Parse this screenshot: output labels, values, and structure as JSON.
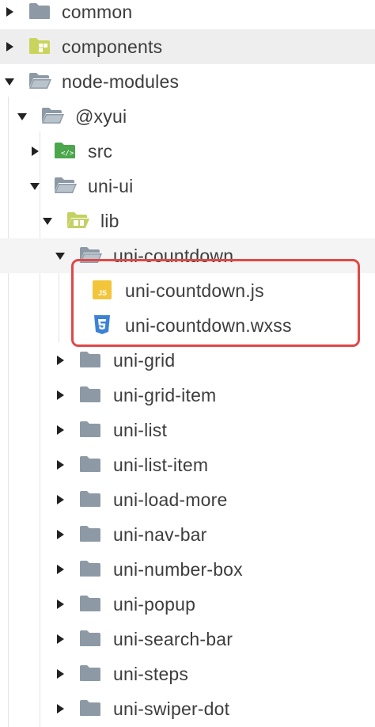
{
  "tree": {
    "items": [
      {
        "label": "common",
        "icon": "folder-icon",
        "expanded": false
      },
      {
        "label": "components",
        "icon": "folder-components-icon",
        "expanded": false,
        "selected": true
      },
      {
        "label": "node-modules",
        "icon": "folder-open-icon",
        "expanded": true
      },
      {
        "label": "@xyui",
        "icon": "folder-open-icon",
        "expanded": true
      },
      {
        "label": "src",
        "icon": "folder-src-icon",
        "expanded": false
      },
      {
        "label": "uni-ui",
        "icon": "folder-open-icon",
        "expanded": true
      },
      {
        "label": "lib",
        "icon": "folder-lib-open-icon",
        "expanded": true
      },
      {
        "label": "uni-countdown",
        "icon": "folder-open-icon",
        "expanded": true
      },
      {
        "label": "uni-countdown.js",
        "icon": "js-file-icon"
      },
      {
        "label": "uni-countdown.wxss",
        "icon": "css-file-icon"
      },
      {
        "label": "uni-grid",
        "icon": "folder-icon",
        "expanded": false
      },
      {
        "label": "uni-grid-item",
        "icon": "folder-icon",
        "expanded": false
      },
      {
        "label": "uni-list",
        "icon": "folder-icon",
        "expanded": false
      },
      {
        "label": "uni-list-item",
        "icon": "folder-icon",
        "expanded": false
      },
      {
        "label": "uni-load-more",
        "icon": "folder-icon",
        "expanded": false
      },
      {
        "label": "uni-nav-bar",
        "icon": "folder-icon",
        "expanded": false
      },
      {
        "label": "uni-number-box",
        "icon": "folder-icon",
        "expanded": false
      },
      {
        "label": "uni-popup",
        "icon": "folder-icon",
        "expanded": false
      },
      {
        "label": "uni-search-bar",
        "icon": "folder-icon",
        "expanded": false
      },
      {
        "label": "uni-steps",
        "icon": "folder-icon",
        "expanded": false
      },
      {
        "label": "uni-swiper-dot",
        "icon": "folder-icon",
        "expanded": false
      }
    ],
    "js_badge": "JS"
  },
  "colors": {
    "folder": "#8d9aa6",
    "components_folder": "#c9d45c",
    "src_folder": "#4ca64c",
    "lib_folder": "#c4d063",
    "js_icon": "#f3c53a",
    "css_icon": "#3b82d6",
    "highlight_box": "#e04848"
  }
}
